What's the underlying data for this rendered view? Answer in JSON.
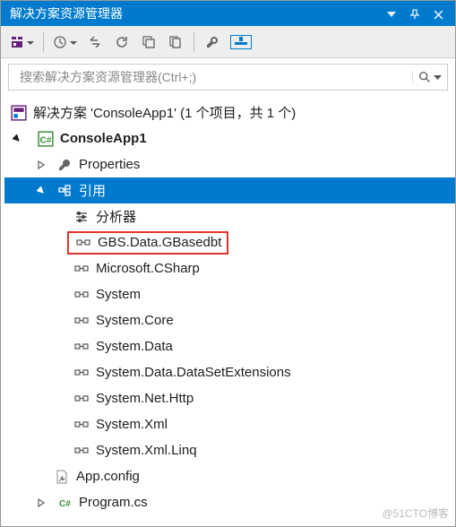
{
  "title": "解决方案资源管理器",
  "search": {
    "placeholder": "搜索解决方案资源管理器(Ctrl+;)"
  },
  "solution": {
    "label": "解决方案 'ConsoleApp1' (1 个项目，共 1 个)",
    "project": {
      "name": "ConsoleApp1",
      "properties": "Properties",
      "references": {
        "label": "引用",
        "analyzer": "分析器",
        "items": [
          "GBS.Data.GBasedbt",
          "Microsoft.CSharp",
          "System",
          "System.Core",
          "System.Data",
          "System.Data.DataSetExtensions",
          "System.Net.Http",
          "System.Xml",
          "System.Xml.Linq"
        ]
      },
      "appconfig": "App.config",
      "programcs": "Program.cs"
    }
  },
  "watermark": "@51CTO博客"
}
